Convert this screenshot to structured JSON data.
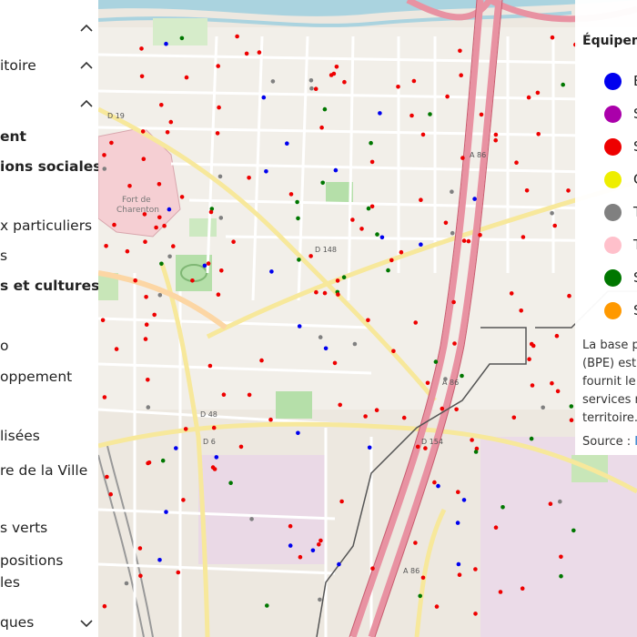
{
  "sidebar": {
    "items": [
      {
        "label": "itoire",
        "bold": false,
        "chevron": "up"
      },
      {
        "label": "",
        "bold": false,
        "chevron": "up"
      },
      {
        "label": "ent",
        "bold": true,
        "chevron": ""
      },
      {
        "label": "ions sociales",
        "bold": true,
        "chevron": ""
      },
      {
        "label": "x particuliers",
        "bold": false,
        "chevron": ""
      },
      {
        "label": "s",
        "bold": false,
        "chevron": ""
      },
      {
        "label": "s et cultures",
        "bold": true,
        "chevron": ""
      },
      {
        "label": "o",
        "bold": false,
        "chevron": ""
      },
      {
        "label": "oppement",
        "bold": false,
        "chevron": ""
      },
      {
        "label": "lisées",
        "bold": false,
        "chevron": ""
      },
      {
        "label": "re de la Ville",
        "bold": false,
        "chevron": ""
      },
      {
        "label": "s verts",
        "bold": false,
        "chevron": ""
      },
      {
        "label": "positions",
        "bold": false,
        "chevron": ""
      },
      {
        "label": "les",
        "bold": false,
        "chevron": ""
      },
      {
        "label": "ques",
        "bold": false,
        "chevron": "down"
      }
    ]
  },
  "map": {
    "labels": {
      "fort": "Fort de",
      "fort2": "Charenton",
      "road_a86": "A 86",
      "road_d6": "D 6",
      "road_d48": "D 48",
      "road_d148": "D 148",
      "road_d19": "D 19",
      "road_d154": "D 154"
    }
  },
  "legend": {
    "title": "Équipem",
    "items": [
      {
        "letter": "E",
        "color": "#0000ee"
      },
      {
        "letter": "S",
        "color": "#aa00aa"
      },
      {
        "letter": "S",
        "color": "#ee0000"
      },
      {
        "letter": "C",
        "color": "#eeee00"
      },
      {
        "letter": "T",
        "color": "#808080"
      },
      {
        "letter": "T",
        "color": "#ffc0cb"
      },
      {
        "letter": "S",
        "color": "#007700"
      },
      {
        "letter": "S",
        "color": "#ff9900"
      }
    ],
    "desc_lines": [
      "La base p",
      "(BPE) est",
      "fournit le",
      "services r",
      "territoire."
    ],
    "source_label": "Source : ",
    "source_link": "I"
  }
}
